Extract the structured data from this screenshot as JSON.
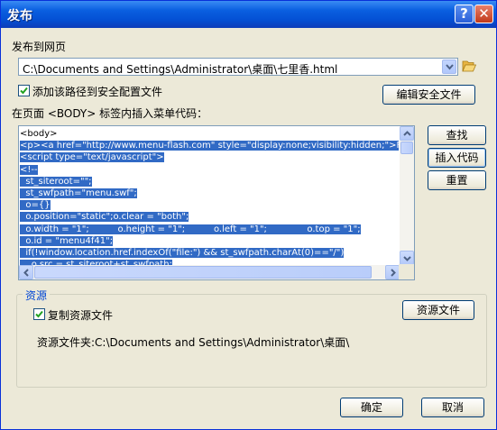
{
  "window": {
    "title": "发布"
  },
  "publish": {
    "label": "发布到网页",
    "path_value": "C:\\Documents and Settings\\Administrator\\桌面\\七里香.html",
    "add_path_checkbox_label": "添加该路径到安全配置文件",
    "add_path_checked": true,
    "edit_security_button": "编辑安全文件"
  },
  "insert": {
    "label": "在页面 <BODY> 标签内插入菜单代码：",
    "find_button": "查找",
    "insert_button": "插入代码",
    "reset_button": "重置"
  },
  "code": {
    "lines": [
      {
        "text": "<body>",
        "selected": false
      },
      {
        "text": "<p><a href=\"http://www.menu-flash.com\" style=\"display:none;visibility:hidden;\">Flash M",
        "selected": true
      },
      {
        "text": "<script type=\"text/javascript\">",
        "selected": true
      },
      {
        "text": "<!--",
        "selected": true
      },
      {
        "text": "  st_siteroot=\"\";",
        "selected": true
      },
      {
        "text": "  st_swfpath=\"menu.swf\";",
        "selected": true
      },
      {
        "text": "  o={}",
        "selected": true
      },
      {
        "text": "  o.position=\"static\";o.clear = \"both\";",
        "selected": true
      },
      {
        "text": "  o.width = \"1\";          o.height = \"1\";          o.left = \"1\";              o.top = \"1\";",
        "selected": true
      },
      {
        "text": "  o.id = \"menu4f41\";",
        "selected": true
      },
      {
        "text": "  if(!window.location.href.indexOf(\"file:\") && st_swfpath.charAt(0)==\"/\")",
        "selected": true
      },
      {
        "text": "    o.src = st_siteroot+st_swfpath;",
        "selected": true
      }
    ]
  },
  "resources": {
    "group_title": "资源",
    "copy_checkbox_label": "复制资源文件",
    "copy_checked": true,
    "resource_file_button": "资源文件",
    "folder_label": "资源文件夹:C:\\Documents and Settings\\Administrator\\桌面\\"
  },
  "footer": {
    "ok_button": "确定",
    "cancel_button": "取消"
  },
  "colors": {
    "selection": "#316ac5",
    "titlebar": "#0450d4",
    "dialog_bg": "#ece9d8"
  },
  "icons": {
    "help": "help-icon",
    "close": "close-icon",
    "dropdown": "chevron-down-icon",
    "browse": "folder-open-icon"
  }
}
